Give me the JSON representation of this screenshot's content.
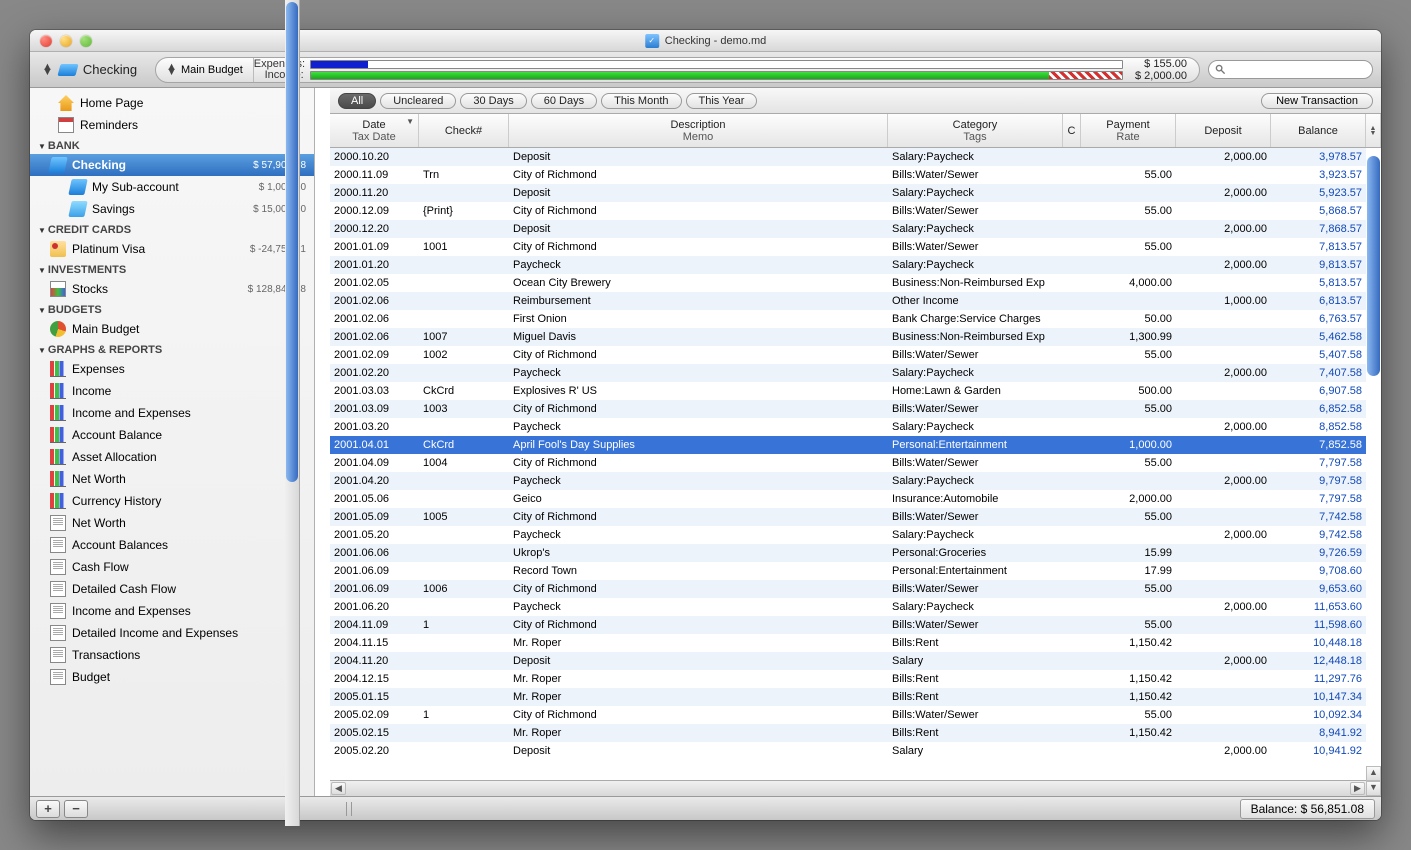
{
  "window": {
    "title": "Checking - demo.md"
  },
  "toolbar": {
    "account": "Checking",
    "budget_selector": "Main Budget",
    "expenses_label": "Expenses:",
    "income_label": "Income:",
    "expenses_value": "$ 155.00",
    "income_value": "$ 2,000.00",
    "search_placeholder": ""
  },
  "sidebar": {
    "home": "Home Page",
    "reminders": "Reminders",
    "sections": {
      "bank": {
        "title": "BANK",
        "items": [
          {
            "label": "Checking",
            "bal": "$ 57,906.08",
            "selected": true
          },
          {
            "label": "My Sub-account",
            "bal": "$ 1,000.00"
          },
          {
            "label": "Savings",
            "bal": "$ 15,000.00"
          }
        ]
      },
      "credit": {
        "title": "CREDIT CARDS",
        "items": [
          {
            "label": "Platinum Visa",
            "bal": "$ -24,751.51"
          }
        ]
      },
      "invest": {
        "title": "INVESTMENTS",
        "items": [
          {
            "label": "Stocks",
            "bal": "$ 128,845.38"
          }
        ]
      },
      "budgets": {
        "title": "BUDGETS",
        "items": [
          {
            "label": "Main Budget"
          }
        ]
      },
      "graphs": {
        "title": "GRAPHS & REPORTS",
        "items": [
          {
            "label": "Expenses",
            "icon": "chart"
          },
          {
            "label": "Income",
            "icon": "chart"
          },
          {
            "label": "Income and Expenses",
            "icon": "chart"
          },
          {
            "label": "Account Balance",
            "icon": "chart"
          },
          {
            "label": "Asset Allocation",
            "icon": "chart"
          },
          {
            "label": "Net Worth",
            "icon": "chart"
          },
          {
            "label": "Currency History",
            "icon": "chart"
          },
          {
            "label": "Net Worth",
            "icon": "doc"
          },
          {
            "label": "Account Balances",
            "icon": "doc"
          },
          {
            "label": "Cash Flow",
            "icon": "doc"
          },
          {
            "label": "Detailed Cash Flow",
            "icon": "doc"
          },
          {
            "label": "Income and Expenses",
            "icon": "doc"
          },
          {
            "label": "Detailed Income and Expenses",
            "icon": "doc"
          },
          {
            "label": "Transactions",
            "icon": "doc"
          },
          {
            "label": "Budget",
            "icon": "doc"
          }
        ]
      }
    }
  },
  "filters": [
    "All",
    "Uncleared",
    "30 Days",
    "60 Days",
    "This Month",
    "This Year"
  ],
  "new_transaction": "New Transaction",
  "columns": {
    "date": "Date",
    "tax_date": "Tax Date",
    "check": "Check#",
    "desc": "Description",
    "memo": "Memo",
    "cat": "Category",
    "tags": "Tags",
    "c": "C",
    "payment": "Payment",
    "rate": "Rate",
    "deposit": "Deposit",
    "balance": "Balance"
  },
  "transactions": [
    {
      "date": "2000.10.20",
      "check": "",
      "desc": "Deposit",
      "cat": "Salary:Paycheck",
      "pay": "",
      "dep": "2,000.00",
      "bal": "3,978.57"
    },
    {
      "date": "2000.11.09",
      "check": "Trn",
      "desc": "City of Richmond",
      "cat": "Bills:Water/Sewer",
      "pay": "55.00",
      "dep": "",
      "bal": "3,923.57"
    },
    {
      "date": "2000.11.20",
      "check": "",
      "desc": "Deposit",
      "cat": "Salary:Paycheck",
      "pay": "",
      "dep": "2,000.00",
      "bal": "5,923.57"
    },
    {
      "date": "2000.12.09",
      "check": "{Print}",
      "desc": "City of Richmond",
      "cat": "Bills:Water/Sewer",
      "pay": "55.00",
      "dep": "",
      "bal": "5,868.57"
    },
    {
      "date": "2000.12.20",
      "check": "",
      "desc": "Deposit",
      "cat": "Salary:Paycheck",
      "pay": "",
      "dep": "2,000.00",
      "bal": "7,868.57"
    },
    {
      "date": "2001.01.09",
      "check": "1001",
      "desc": "City of Richmond",
      "cat": "Bills:Water/Sewer",
      "pay": "55.00",
      "dep": "",
      "bal": "7,813.57"
    },
    {
      "date": "2001.01.20",
      "check": "",
      "desc": "Paycheck",
      "cat": "Salary:Paycheck",
      "pay": "",
      "dep": "2,000.00",
      "bal": "9,813.57"
    },
    {
      "date": "2001.02.05",
      "check": "",
      "desc": "Ocean City Brewery",
      "cat": "Business:Non-Reimbursed Exp",
      "pay": "4,000.00",
      "dep": "",
      "bal": "5,813.57"
    },
    {
      "date": "2001.02.06",
      "check": "",
      "desc": "Reimbursement",
      "cat": "Other Income",
      "pay": "",
      "dep": "1,000.00",
      "bal": "6,813.57"
    },
    {
      "date": "2001.02.06",
      "check": "",
      "desc": "First Onion",
      "cat": "Bank Charge:Service Charges",
      "pay": "50.00",
      "dep": "",
      "bal": "6,763.57"
    },
    {
      "date": "2001.02.06",
      "check": "1007",
      "desc": "Miguel Davis",
      "cat": "Business:Non-Reimbursed Exp",
      "pay": "1,300.99",
      "dep": "",
      "bal": "5,462.58"
    },
    {
      "date": "2001.02.09",
      "check": "1002",
      "desc": "City of Richmond",
      "cat": "Bills:Water/Sewer",
      "pay": "55.00",
      "dep": "",
      "bal": "5,407.58"
    },
    {
      "date": "2001.02.20",
      "check": "",
      "desc": "Paycheck",
      "cat": "Salary:Paycheck",
      "pay": "",
      "dep": "2,000.00",
      "bal": "7,407.58"
    },
    {
      "date": "2001.03.03",
      "check": "CkCrd",
      "desc": "Explosives R' US",
      "cat": "Home:Lawn & Garden",
      "pay": "500.00",
      "dep": "",
      "bal": "6,907.58"
    },
    {
      "date": "2001.03.09",
      "check": "1003",
      "desc": "City of Richmond",
      "cat": "Bills:Water/Sewer",
      "pay": "55.00",
      "dep": "",
      "bal": "6,852.58"
    },
    {
      "date": "2001.03.20",
      "check": "",
      "desc": "Paycheck",
      "cat": "Salary:Paycheck",
      "pay": "",
      "dep": "2,000.00",
      "bal": "8,852.58"
    },
    {
      "date": "2001.04.01",
      "check": "CkCrd",
      "desc": "April Fool's Day Supplies",
      "cat": "Personal:Entertainment",
      "pay": "1,000.00",
      "dep": "",
      "bal": "7,852.58",
      "selected": true
    },
    {
      "date": "2001.04.09",
      "check": "1004",
      "desc": "City of Richmond",
      "cat": "Bills:Water/Sewer",
      "pay": "55.00",
      "dep": "",
      "bal": "7,797.58"
    },
    {
      "date": "2001.04.20",
      "check": "",
      "desc": "Paycheck",
      "cat": "Salary:Paycheck",
      "pay": "",
      "dep": "2,000.00",
      "bal": "9,797.58"
    },
    {
      "date": "2001.05.06",
      "check": "",
      "desc": "Geico",
      "cat": "Insurance:Automobile",
      "pay": "2,000.00",
      "dep": "",
      "bal": "7,797.58"
    },
    {
      "date": "2001.05.09",
      "check": "1005",
      "desc": "City of Richmond",
      "cat": "Bills:Water/Sewer",
      "pay": "55.00",
      "dep": "",
      "bal": "7,742.58"
    },
    {
      "date": "2001.05.20",
      "check": "",
      "desc": "Paycheck",
      "cat": "Salary:Paycheck",
      "pay": "",
      "dep": "2,000.00",
      "bal": "9,742.58"
    },
    {
      "date": "2001.06.06",
      "check": "",
      "desc": "Ukrop's",
      "cat": "Personal:Groceries",
      "pay": "15.99",
      "dep": "",
      "bal": "9,726.59"
    },
    {
      "date": "2001.06.09",
      "check": "",
      "desc": "Record Town",
      "cat": "Personal:Entertainment",
      "pay": "17.99",
      "dep": "",
      "bal": "9,708.60"
    },
    {
      "date": "2001.06.09",
      "check": "1006",
      "desc": "City of Richmond",
      "cat": "Bills:Water/Sewer",
      "pay": "55.00",
      "dep": "",
      "bal": "9,653.60"
    },
    {
      "date": "2001.06.20",
      "check": "",
      "desc": "Paycheck",
      "cat": "Salary:Paycheck",
      "pay": "",
      "dep": "2,000.00",
      "bal": "11,653.60"
    },
    {
      "date": "2004.11.09",
      "check": "1",
      "desc": "City of Richmond",
      "cat": "Bills:Water/Sewer",
      "pay": "55.00",
      "dep": "",
      "bal": "11,598.60"
    },
    {
      "date": "2004.11.15",
      "check": "",
      "desc": "Mr. Roper",
      "cat": "Bills:Rent",
      "pay": "1,150.42",
      "dep": "",
      "bal": "10,448.18"
    },
    {
      "date": "2004.11.20",
      "check": "",
      "desc": "Deposit",
      "cat": "Salary",
      "pay": "",
      "dep": "2,000.00",
      "bal": "12,448.18"
    },
    {
      "date": "2004.12.15",
      "check": "",
      "desc": "Mr. Roper",
      "cat": "Bills:Rent",
      "pay": "1,150.42",
      "dep": "",
      "bal": "11,297.76"
    },
    {
      "date": "2005.01.15",
      "check": "",
      "desc": "Mr. Roper",
      "cat": "Bills:Rent",
      "pay": "1,150.42",
      "dep": "",
      "bal": "10,147.34"
    },
    {
      "date": "2005.02.09",
      "check": "1",
      "desc": "City of Richmond",
      "cat": "Bills:Water/Sewer",
      "pay": "55.00",
      "dep": "",
      "bal": "10,092.34"
    },
    {
      "date": "2005.02.15",
      "check": "",
      "desc": "Mr. Roper",
      "cat": "Bills:Rent",
      "pay": "1,150.42",
      "dep": "",
      "bal": "8,941.92"
    },
    {
      "date": "2005.02.20",
      "check": "",
      "desc": "Deposit",
      "cat": "Salary",
      "pay": "",
      "dep": "2,000.00",
      "bal": "10,941.92"
    }
  ],
  "footer": {
    "balance": "Balance: $ 56,851.08"
  }
}
